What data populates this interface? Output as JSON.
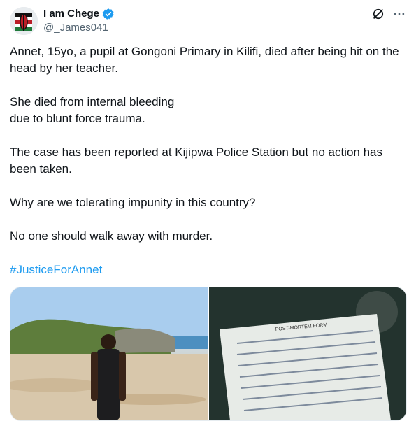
{
  "author": {
    "display_name": "I am Chege",
    "handle": "@_James041"
  },
  "icons": {
    "verified": "verified-badge-icon",
    "grok": "grok-icon",
    "more": "more-icon"
  },
  "colors": {
    "text": "#0f1419",
    "secondary": "#536471",
    "link": "#1d9bf0",
    "verified": "#1d9bf0"
  },
  "tweet": {
    "paragraphs": [
      "Annet, 15yo, a pupil at Gongoni Primary in Kilifi, died after being hit on the head by her teacher.",
      "She died from internal bleeding\ndue to blunt force trauma.",
      "The case has been reported at Kijipwa Police Station but no action has been taken.",
      "Why are we tolerating impunity in this country?",
      "No one should walk away with murder."
    ],
    "hashtag": "#JusticeForAnnet"
  },
  "media": {
    "images": [
      "beach-photo",
      "postmortem-form-photo"
    ],
    "form_heading": "POST-MORTEM FORM"
  }
}
